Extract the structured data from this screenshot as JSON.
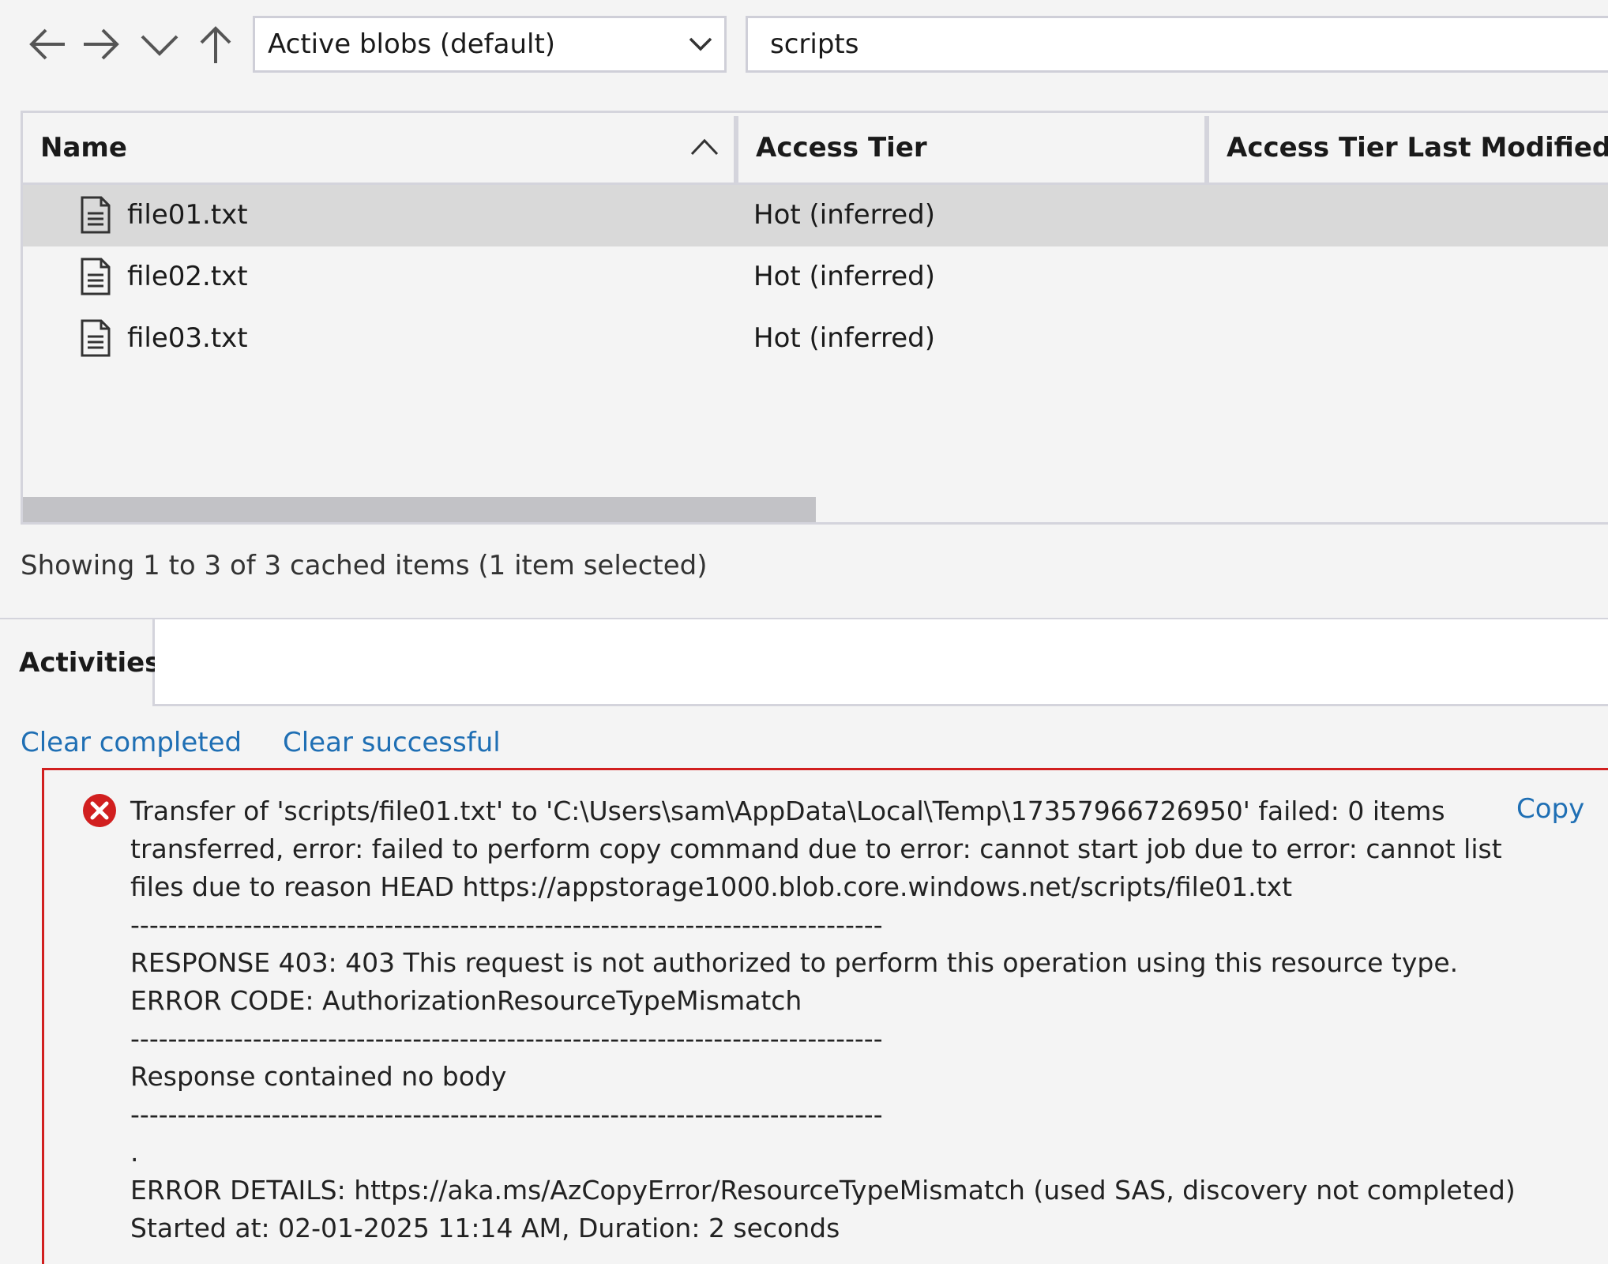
{
  "toolbar": {
    "filter_selected": "Active blobs (default)",
    "path_value": "scripts"
  },
  "table": {
    "columns": [
      "Name",
      "Access Tier",
      "Access Tier Last Modified"
    ],
    "rows": [
      {
        "name": "file01.txt",
        "tier": "Hot (inferred)",
        "selected": true
      },
      {
        "name": "file02.txt",
        "tier": "Hot (inferred)",
        "selected": false
      },
      {
        "name": "file03.txt",
        "tier": "Hot (inferred)",
        "selected": false
      }
    ]
  },
  "status_text": "Showing 1 to 3 of 3 cached items (1 item selected)",
  "activities": {
    "tab_label": "Activities",
    "clear_completed": "Clear completed",
    "clear_successful": "Clear successful",
    "copy_label": "Copy",
    "error_lines": [
      "Transfer of 'scripts/file01.txt' to 'C:\\Users\\sam\\AppData\\Local\\Temp\\17357966726950' failed: 0 items",
      "transferred, error: failed to perform copy command due to error: cannot start job due to error: cannot list",
      "files due to reason HEAD https://appstorage1000.blob.core.windows.net/scripts/file01.txt",
      "--------------------------------------------------------------------------------",
      "RESPONSE 403: 403 This request is not authorized to perform this operation using this resource type.",
      "ERROR CODE: AuthorizationResourceTypeMismatch",
      "--------------------------------------------------------------------------------",
      "Response contained no body",
      "--------------------------------------------------------------------------------",
      ".",
      "ERROR DETAILS: https://aka.ms/AzCopyError/ResourceTypeMismatch (used SAS, discovery not completed)",
      "Started at: 02-01-2025 11:14 AM, Duration: 2 seconds"
    ]
  }
}
